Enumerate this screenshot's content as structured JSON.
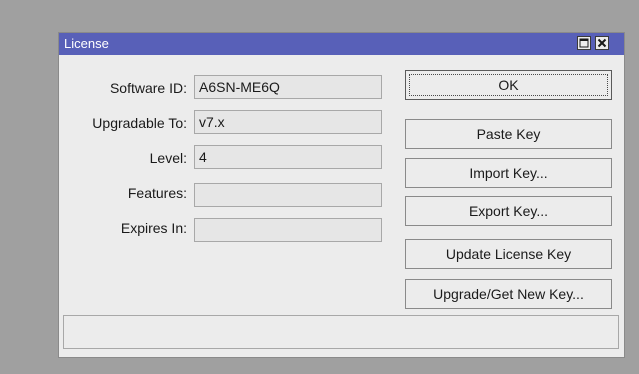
{
  "window": {
    "title": "License"
  },
  "fields": [
    {
      "label": "Software ID:",
      "value": "A6SN-ME6Q"
    },
    {
      "label": "Upgradable To:",
      "value": "v7.x"
    },
    {
      "label": "Level:",
      "value": "4"
    },
    {
      "label": "Features:",
      "value": ""
    },
    {
      "label": "Expires In:",
      "value": ""
    }
  ],
  "buttons": {
    "ok": "OK",
    "paste_key": "Paste Key",
    "import_key": "Import Key...",
    "export_key": "Export Key...",
    "update_license_key": "Update License Key",
    "upgrade_get_new_key": "Upgrade/Get New Key..."
  },
  "status": {
    "text": ""
  },
  "icons": {
    "maximize": "maximize-icon",
    "close": "close-icon"
  },
  "colors": {
    "titlebar": "#5860b8",
    "background": "#a0a0a0",
    "dialog": "#ececec"
  }
}
